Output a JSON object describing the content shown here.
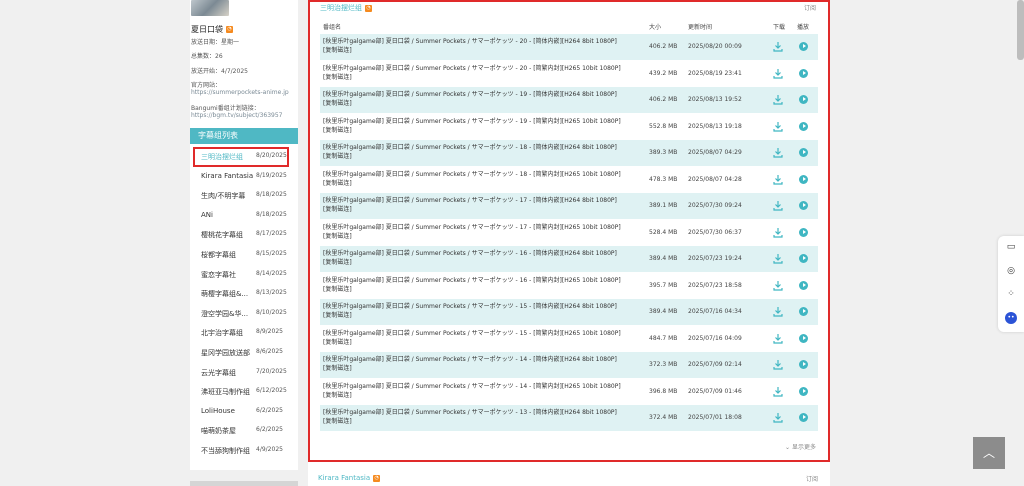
{
  "anime": {
    "title": "夏日口袋",
    "air_day": "放送日期：星期一",
    "episodes": "总集数：26",
    "start": "放送开始：4/7/2025",
    "official_label": "官方网站：",
    "official_url": "https://summerpockets-anime.jp",
    "bangumi_label": "Bangumi番组计划链接：",
    "bangumi_url": "https://bgm.tv/subject/363957"
  },
  "subgroups": {
    "header": "字幕组列表",
    "items": [
      {
        "name": "三明治摆烂组",
        "date": "8/20/2025"
      },
      {
        "name": "Kirara Fantasia",
        "date": "8/19/2025"
      },
      {
        "name": "生肉/不明字幕",
        "date": "8/18/2025"
      },
      {
        "name": "ANi",
        "date": "8/18/2025"
      },
      {
        "name": "樱桃花字幕组",
        "date": "8/17/2025"
      },
      {
        "name": "桜都字幕组",
        "date": "8/15/2025"
      },
      {
        "name": "蜜恋字幕社",
        "date": "8/14/2025"
      },
      {
        "name": "萌樱字幕组&...",
        "date": "8/13/2025"
      },
      {
        "name": "澄空学园&华...",
        "date": "8/10/2025"
      },
      {
        "name": "北宇治字幕组",
        "date": "8/9/2025"
      },
      {
        "name": "星冈学园放送部",
        "date": "8/6/2025"
      },
      {
        "name": "云光字幕组",
        "date": "7/20/2025"
      },
      {
        "name": "沸班亚马制作组",
        "date": "6/12/2025"
      },
      {
        "name": "LoliHouse",
        "date": "6/2/2025"
      },
      {
        "name": "喵萌奶茶屋",
        "date": "6/2/2025"
      },
      {
        "name": "不当舔狗制作组",
        "date": "4/9/2025"
      }
    ]
  },
  "section": {
    "title": "三明治摆烂组",
    "subscribe": "订阅",
    "col_name": "番组名",
    "col_size": "大小",
    "col_time": "更新时间",
    "col_download": "下载",
    "col_play": "播放",
    "show_more": "显示更多",
    "copy_magnet": "[复制磁连]"
  },
  "episodes": [
    {
      "name": "[秋里乐叶galgame部] 夏日口袋 / Summer Pockets / サマーポケッツ - 20 - [简体内嵌][H264 8bit 1080P]",
      "size": "406.2 MB",
      "time": "2025/08/20 00:09"
    },
    {
      "name": "[秋里乐叶galgame部] 夏日口袋 / Summer Pockets / サマーポケッツ - 20 - [简繁内封][H265 10bit 1080P]",
      "size": "439.2 MB",
      "time": "2025/08/19 23:41"
    },
    {
      "name": "[秋里乐叶galgame部] 夏日口袋 / Summer Pockets / サマーポケッツ - 19 - [简体内嵌][H264 8bit 1080P]",
      "size": "406.2 MB",
      "time": "2025/08/13 19:52"
    },
    {
      "name": "[秋里乐叶galgame部] 夏日口袋 / Summer Pockets / サマーポケッツ - 19 - [简繁内封][H265 10bit 1080P]",
      "size": "552.8 MB",
      "time": "2025/08/13 19:18"
    },
    {
      "name": "[秋里乐叶galgame部] 夏日口袋 / Summer Pockets / サマーポケッツ - 18 - [简体内嵌][H264 8bit 1080P]",
      "size": "389.3 MB",
      "time": "2025/08/07 04:29"
    },
    {
      "name": "[秋里乐叶galgame部] 夏日口袋 / Summer Pockets / サマーポケッツ - 18 - [简繁内封][H265 10bit 1080P]",
      "size": "478.3 MB",
      "time": "2025/08/07 04:28"
    },
    {
      "name": "[秋里乐叶galgame部] 夏日口袋 / Summer Pockets / サマーポケッツ - 17 - [简体内嵌][H264 8bit 1080P]",
      "size": "389.1 MB",
      "time": "2025/07/30 09:24"
    },
    {
      "name": "[秋里乐叶galgame部] 夏日口袋 / Summer Pockets / サマーポケッツ - 17 - [简繁内封][H265 10bit 1080P]",
      "size": "528.4 MB",
      "time": "2025/07/30 06:37"
    },
    {
      "name": "[秋里乐叶galgame部] 夏日口袋 / Summer Pockets / サマーポケッツ - 16 - [简体内嵌][H264 8bit 1080P]",
      "size": "389.4 MB",
      "time": "2025/07/23 19:24"
    },
    {
      "name": "[秋里乐叶galgame部] 夏日口袋 / Summer Pockets / サマーポケッツ - 16 - [简繁内封][H265 10bit 1080P]",
      "size": "395.7 MB",
      "time": "2025/07/23 18:58"
    },
    {
      "name": "[秋里乐叶galgame部] 夏日口袋 / Summer Pockets / サマーポケッツ - 15 - [简体内嵌][H264 8bit 1080P]",
      "size": "389.4 MB",
      "time": "2025/07/16 04:34"
    },
    {
      "name": "[秋里乐叶galgame部] 夏日口袋 / Summer Pockets / サマーポケッツ - 15 - [简繁内封][H265 10bit 1080P]",
      "size": "484.7 MB",
      "time": "2025/07/16 04:09"
    },
    {
      "name": "[秋里乐叶galgame部] 夏日口袋 / Summer Pockets / サマーポケッツ - 14 - [简体内嵌][H264 8bit 1080P]",
      "size": "372.3 MB",
      "time": "2025/07/09 02:14"
    },
    {
      "name": "[秋里乐叶galgame部] 夏日口袋 / Summer Pockets / サマーポケッツ - 14 - [简繁内封][H265 10bit 1080P]",
      "size": "396.8 MB",
      "time": "2025/07/09 01:46"
    },
    {
      "name": "[秋里乐叶galgame部] 夏日口袋 / Summer Pockets / サマーポケッツ - 13 - [简体内嵌][H264 8bit 1080P]",
      "size": "372.4 MB",
      "time": "2025/07/01 18:08"
    }
  ],
  "next_section": {
    "title": "Kirara Fantasia",
    "subscribe": "订阅"
  },
  "colors": {
    "accent": "#4fb8c4",
    "highlight_border": "#e02a2a",
    "row_alt": "#dff2f3",
    "rss": "#f58a1f"
  },
  "icons": [
    "rss-icon",
    "download-icon",
    "play-icon",
    "chevron-down-icon",
    "book-icon",
    "palette-icon",
    "grid-icon",
    "bot-icon",
    "arrow-up-icon"
  ]
}
